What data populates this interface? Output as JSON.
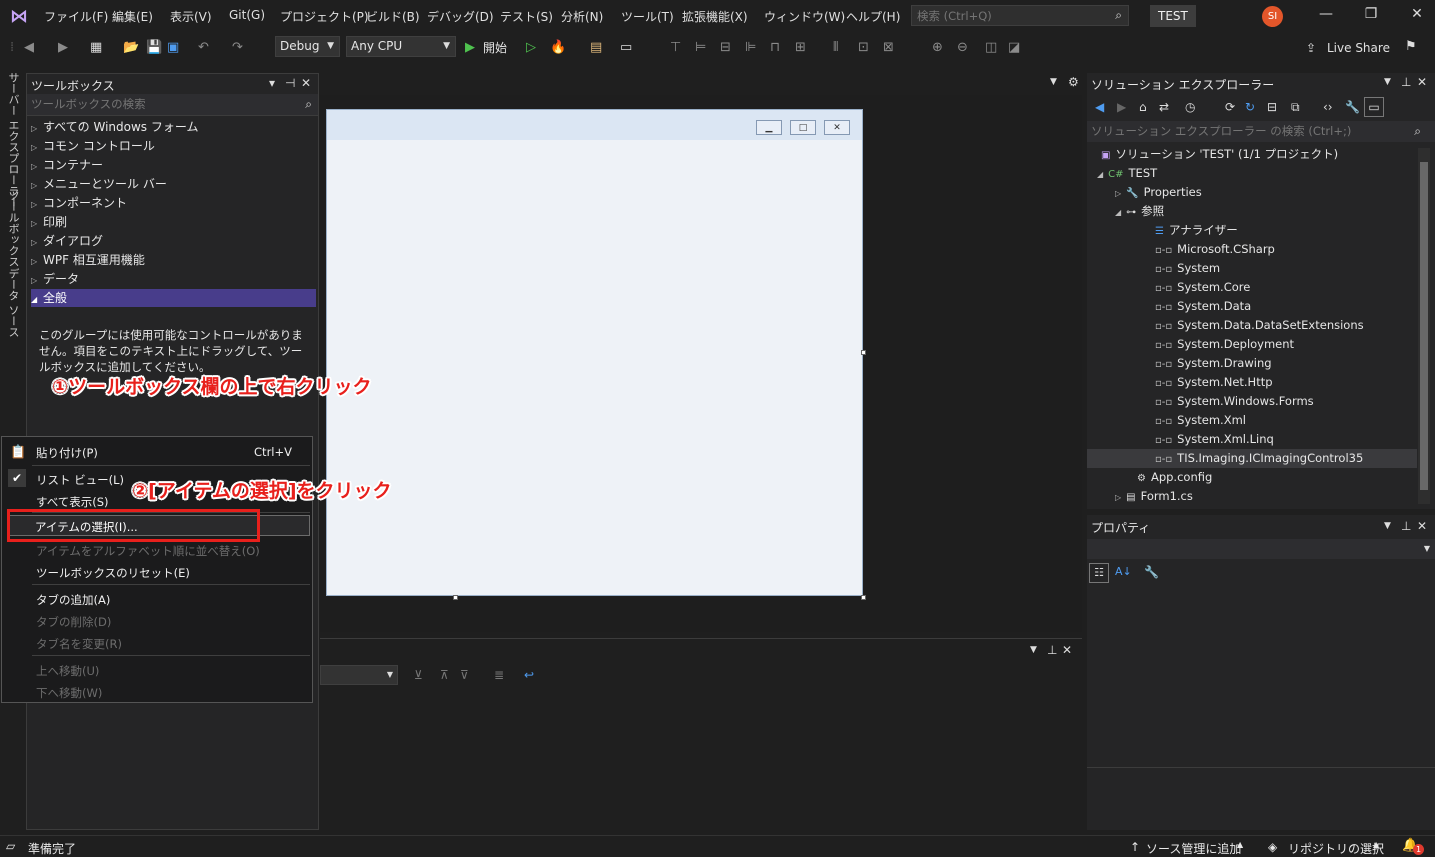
{
  "menu": {
    "items": [
      "ファイル(F)",
      "編集(E)",
      "表示(V)",
      "Git(G)",
      "プロジェクト(P)",
      "ビルド(B)",
      "デバッグ(D)",
      "テスト(S)",
      "分析(N)",
      "ツール(T)",
      "拡張機能(X)",
      "ウィンドウ(W)",
      "ヘルプ(H)"
    ],
    "search_placeholder": "検索 (Ctrl+Q)",
    "solution_name": "TEST",
    "avatar_initials": "SI"
  },
  "toolbar": {
    "config": "Debug",
    "platform": "Any CPU",
    "start_label": "開始",
    "liveshare_label": "Live Share"
  },
  "sidebar_tabs": [
    "サーバー エクスプローラー",
    "ツールボックス",
    "データ ソース"
  ],
  "toolbox": {
    "title": "ツールボックス",
    "search_placeholder": "ツールボックスの検索",
    "categories": [
      "すべての Windows フォーム",
      "コモン コントロール",
      "コンテナー",
      "メニューとツール バー",
      "コンポーネント",
      "印刷",
      "ダイアログ",
      "WPF 相互運用機能",
      "データ",
      "全般"
    ],
    "empty_message": "このグループには使用可能なコントロールがありません。項目をこのテキスト上にドラッグして、ツールボックスに追加してください。"
  },
  "context_menu": {
    "paste": "貼り付け(P)",
    "paste_shortcut": "Ctrl+V",
    "list_view": "リスト ビュー(L)",
    "show_all": "すべて表示(S)",
    "choose_items": "アイテムの選択(I)...",
    "sort_alpha": "アイテムをアルファベット順に並べ替え(O)",
    "reset_toolbox": "ツールボックスのリセット(E)",
    "add_tab": "タブの追加(A)",
    "delete_tab": "タブの削除(D)",
    "rename_tab": "タブ名を変更(R)",
    "move_up": "上へ移動(U)",
    "move_down": "下へ移動(W)"
  },
  "annotations": {
    "step1": "①ツールボックス欄の上で右クリック",
    "step2": "②[アイテムの選択]をクリック"
  },
  "solution_explorer": {
    "title": "ソリューション エクスプローラー",
    "search_placeholder": "ソリューション エクスプローラー の検索 (Ctrl+;)",
    "solution_label": "ソリューション 'TEST' (1/1 プロジェクト)",
    "project": "TEST",
    "properties": "Properties",
    "references": "参照",
    "analyzers": "アナライザー",
    "reference_items": [
      "Microsoft.CSharp",
      "System",
      "System.Core",
      "System.Data",
      "System.Data.DataSetExtensions",
      "System.Deployment",
      "System.Drawing",
      "System.Net.Http",
      "System.Windows.Forms",
      "System.Xml",
      "System.Xml.Linq",
      "TIS.Imaging.ICImagingControl35"
    ],
    "app_config": "App.config",
    "form1": "Form1.cs"
  },
  "properties": {
    "title": "プロパティ"
  },
  "status": {
    "ready": "準備完了",
    "source_control": "ソース管理に追加",
    "repository": "リポジトリの選択",
    "notifications": "1"
  }
}
